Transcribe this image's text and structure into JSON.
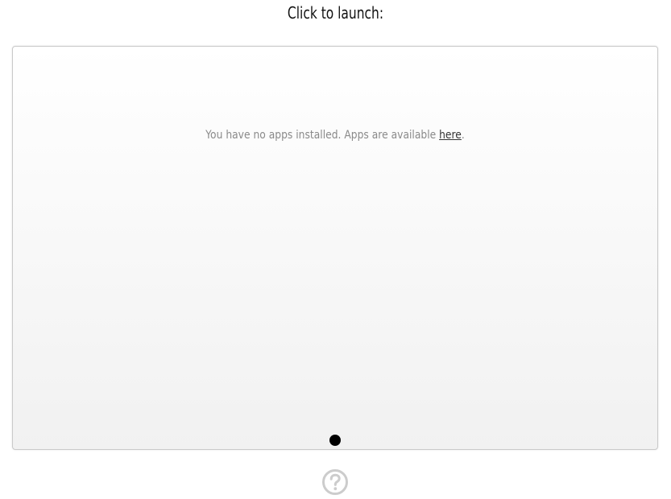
{
  "header": {
    "title": "Click to launch:"
  },
  "panel": {
    "message_before": "You have no apps installed. Apps are available ",
    "link_text": "here",
    "message_after": ".",
    "pages": 1,
    "current_page": 1
  },
  "footer": {
    "help_icon": "help-icon"
  },
  "colors": {
    "panel_border": "#c9c9c9",
    "message_text": "#8a8a8a",
    "dot": "#000000",
    "help_icon": "#cccccc"
  }
}
